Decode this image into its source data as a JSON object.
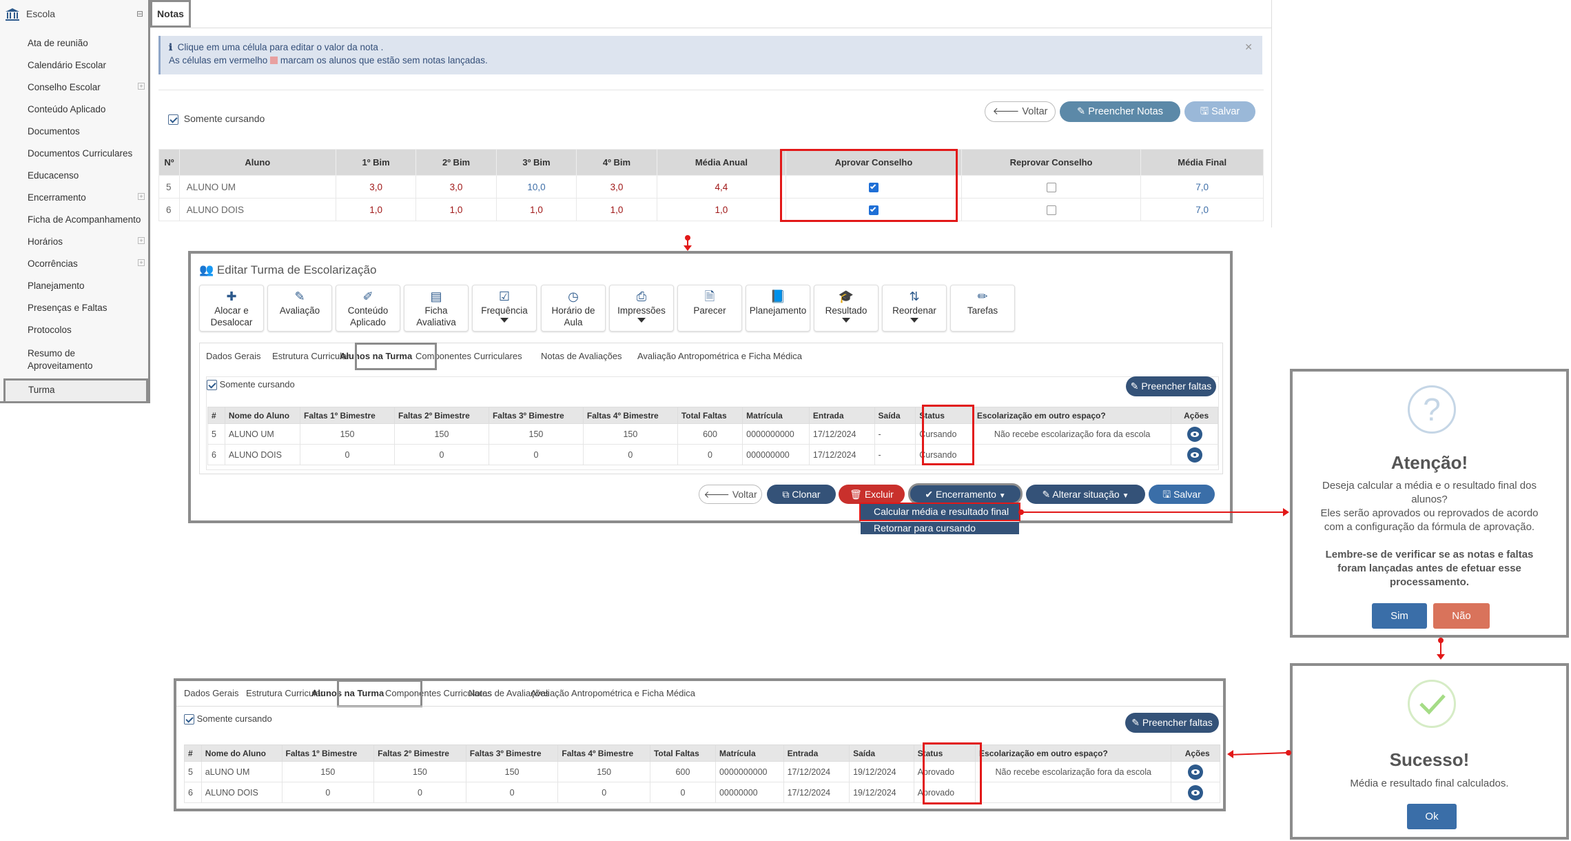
{
  "sidebar": {
    "header": "Escola",
    "items": [
      "Ata de reunião",
      "Calendário Escolar",
      "Conselho Escolar",
      "Conteúdo Aplicado",
      "Documentos",
      "Documentos Curriculares",
      "Educacenso",
      "Encerramento",
      "Ficha de Acompanhamento",
      "Horários",
      "Ocorrências",
      "Planejamento",
      "Presenças e Faltas",
      "Protocolos",
      "Resumo de Aproveitamento"
    ],
    "selected": "Turma"
  },
  "notas": {
    "tab": "Notas",
    "info_line1": "Clique em uma célula para editar o valor da nota .",
    "info_line2a": "As células em vermelho",
    "info_line2b": "marcam os alunos que estão sem notas lançadas.",
    "somente_cursando": "Somente cursando",
    "voltar": "Voltar",
    "preencher_notas": "Preencher Notas",
    "salvar": "Salvar",
    "columns": [
      "Nº",
      "Aluno",
      "1º Bim",
      "2º Bim",
      "3º Bim",
      "4º Bim",
      "Média Anual",
      "Aprovar Conselho",
      "Reprovar Conselho",
      "Média Final"
    ],
    "rows": [
      {
        "n": "5",
        "aluno": "ALUNO UM",
        "b1": "3,0",
        "b2": "3,0",
        "b3": "10,0",
        "b4": "3,0",
        "media": "4,4",
        "final": "7,0"
      },
      {
        "n": "6",
        "aluno": "ALUNO DOIS",
        "b1": "1,0",
        "b2": "1,0",
        "b3": "1,0",
        "b4": "1,0",
        "media": "1,0",
        "final": "7,0"
      }
    ]
  },
  "edit": {
    "title": "Editar Turma de Escolarização",
    "toolbar": [
      {
        "l1": "Alocar e",
        "l2": "Desalocar"
      },
      {
        "l1": "Avaliação",
        "l2": ""
      },
      {
        "l1": "Conteúdo",
        "l2": "Aplicado"
      },
      {
        "l1": "Ficha",
        "l2": "Avaliativa"
      },
      {
        "l1": "Frequência",
        "l2": ""
      },
      {
        "l1": "Horário de",
        "l2": "Aula"
      },
      {
        "l1": "Impressões",
        "l2": ""
      },
      {
        "l1": "Parecer",
        "l2": ""
      },
      {
        "l1": "Planejamento",
        "l2": ""
      },
      {
        "l1": "Resultado",
        "l2": ""
      },
      {
        "l1": "Reordenar",
        "l2": ""
      },
      {
        "l1": "Tarefas",
        "l2": ""
      }
    ],
    "tabs": [
      "Dados Gerais",
      "Estrutura Curricular",
      "Alunos na Turma",
      "Componentes Curriculares",
      "Notas de Avaliações",
      "Avaliação Antropométrica e Ficha Médica"
    ],
    "somente_cursando": "Somente cursando",
    "preencher_faltas": "Preencher faltas",
    "columns": [
      "#",
      "Nome do Aluno",
      "Faltas 1º Bimestre",
      "Faltas 2º Bimestre",
      "Faltas 3º Bimestre",
      "Faltas 4º Bimestre",
      "Total Faltas",
      "Matrícula",
      "Entrada",
      "Saída",
      "Status",
      "Escolarização em outro espaço?",
      "Ações"
    ],
    "rows": [
      {
        "n": "5",
        "nome": "ALUNO UM",
        "f1": "150",
        "f2": "150",
        "f3": "150",
        "f4": "150",
        "total": "600",
        "mat": "0000000000",
        "entrada": "17/12/2024",
        "saida": "-",
        "status": "Cursando",
        "esc": "Não recebe escolarização fora da escola"
      },
      {
        "n": "6",
        "nome": "ALUNO DOIS",
        "f1": "0",
        "f2": "0",
        "f3": "0",
        "f4": "0",
        "total": "0",
        "mat": "000000000",
        "entrada": "17/12/2024",
        "saida": "-",
        "status": "Cursando",
        "esc": ""
      }
    ],
    "buttons": {
      "voltar": "Voltar",
      "clonar": "Clonar",
      "excluir": "Excluir",
      "encerramento": "Encerramento",
      "alterar": "Alterar situação",
      "salvar": "Salvar"
    },
    "dropdown": [
      "Calcular média e resultado final",
      "Retornar para cursando"
    ]
  },
  "bottom": {
    "tabs": [
      "Dados Gerais",
      "Estrutura Curricular",
      "Alunos na Turma",
      "Componentes Curriculares",
      "Notas de Avaliações",
      "Avaliação Antropométrica e Ficha Médica"
    ],
    "somente_cursando": "Somente cursando",
    "preencher_faltas": "Preencher faltas",
    "columns": [
      "#",
      "Nome do Aluno",
      "Faltas 1º Bimestre",
      "Faltas 2º Bimestre",
      "Faltas 3º Bimestre",
      "Faltas 4º Bimestre",
      "Total Faltas",
      "Matrícula",
      "Entrada",
      "Saída",
      "Status",
      "Escolarização em outro espaço?",
      "Ações"
    ],
    "rows": [
      {
        "n": "5",
        "nome": "aLUNO UM",
        "f1": "150",
        "f2": "150",
        "f3": "150",
        "f4": "150",
        "total": "600",
        "mat": "0000000000",
        "entrada": "17/12/2024",
        "saida": "19/12/2024",
        "status": "Aprovado",
        "esc": "Não recebe escolarização fora da escola"
      },
      {
        "n": "6",
        "nome": "ALUNO DOIS",
        "f1": "0",
        "f2": "0",
        "f3": "0",
        "f4": "0",
        "total": "0",
        "mat": "00000000",
        "entrada": "17/12/2024",
        "saida": "19/12/2024",
        "status": "Aprovado",
        "esc": ""
      }
    ]
  },
  "dialog_confirm": {
    "icon": "?",
    "title": "Atenção!",
    "l1": "Deseja calcular a média e o resultado final dos",
    "l2": "alunos?",
    "l3": "Eles serão aprovados ou reprovados de acordo",
    "l4": "com a configuração da fórmula de aprovação.",
    "b1": "Lembre-se de verificar se as notas e faltas",
    "b2": "foram lançadas antes de efetuar esse",
    "b3": "processamento.",
    "yes": "Sim",
    "no": "Não"
  },
  "dialog_success": {
    "title": "Sucesso!",
    "text": "Média e resultado final calculados.",
    "ok": "Ok"
  },
  "colors": {
    "accent": "#2d5a8c",
    "highlight": "#e21818",
    "confirm": "#3a6ea8",
    "cancel": "#d9735b"
  }
}
